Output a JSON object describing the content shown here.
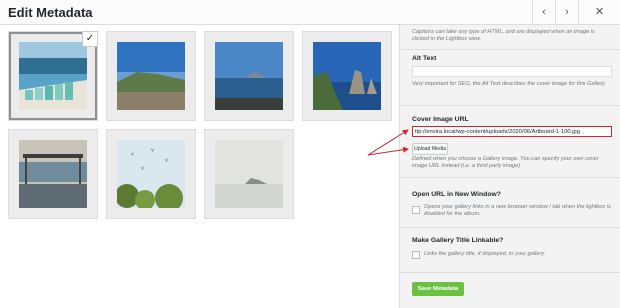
{
  "header": {
    "title": "Edit Metadata",
    "prev_icon": "‹",
    "next_icon": "›",
    "close_icon": "✕"
  },
  "gallery": {
    "selected_check": "✓"
  },
  "panel": {
    "intro": "Captions can take any type of HTML, and are displayed when an image is clicked in the Lightbox view.",
    "alt_label": "Alt Text",
    "alt_value": "",
    "alt_help": "Very important for SEO, the Alt Text describes the cover image for this Gallery.",
    "cover_label": "Cover Image URL",
    "cover_value": "ttp://envira.local/wp-content/uploads/2020/06/Artboard-1-100.jpg",
    "upload_label": "Upload Media",
    "cover_help": "Defined when you choose a Gallery image. You can specify your own cover image URL instead (i.e. a third party image)",
    "open_url_label": "Open URL in New Window?",
    "open_url_help": "Opens your gallery links in a new browser window / tab when the lightbox is disabled for the album.",
    "title_link_label": "Make Gallery Title Linkable?",
    "title_link_help": "Links the gallery title, if displayed, to your gallery.",
    "save_label": "Save Metadata"
  },
  "colors": {
    "accent": "#d0262d",
    "save": "#6bbf41"
  }
}
